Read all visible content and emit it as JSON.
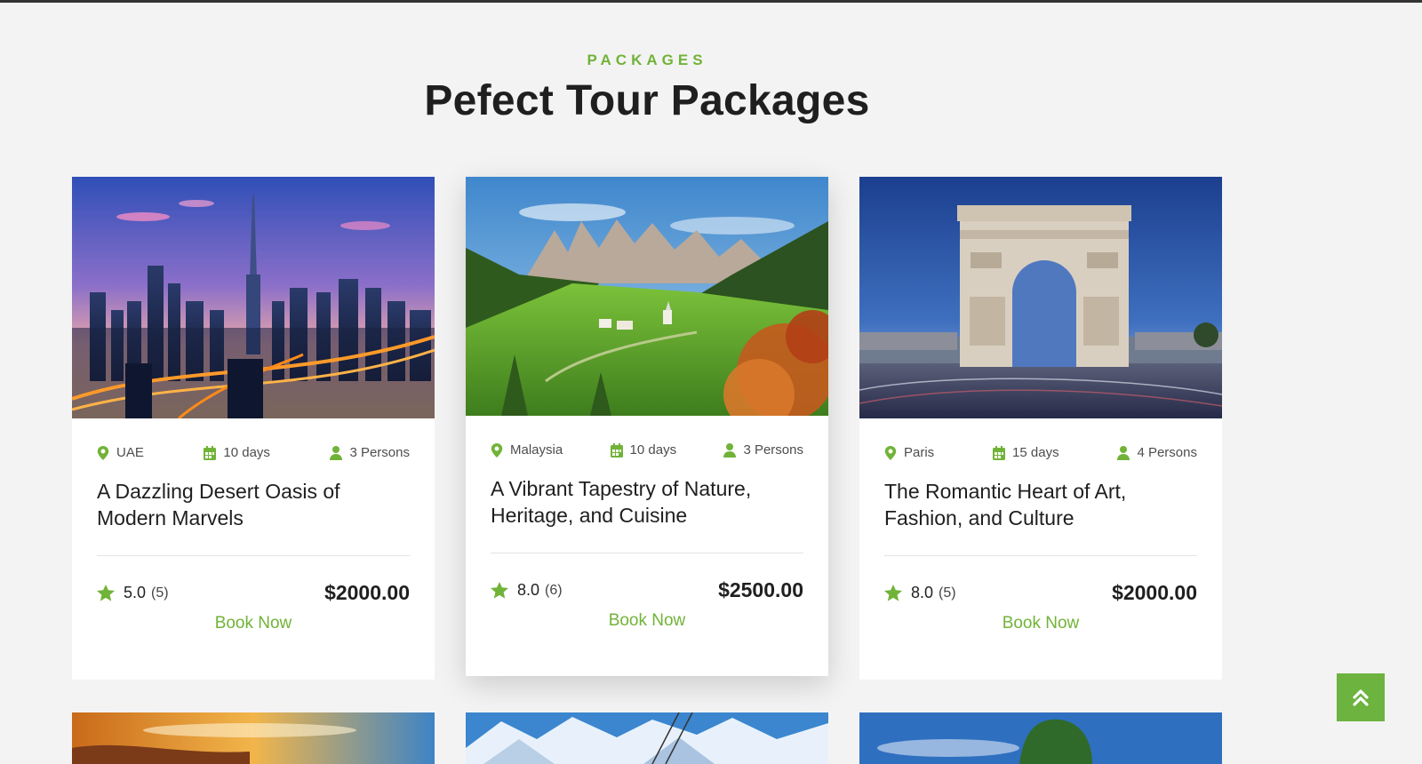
{
  "section": {
    "eyebrow": "PACKAGES",
    "title": "Pefect Tour Packages"
  },
  "colors": {
    "accent": "#71b338",
    "background": "#f3f3f3",
    "card": "#ffffff",
    "text": "#1f1f1f"
  },
  "packages": [
    {
      "location": "UAE",
      "duration": "10 days",
      "persons": "3 Persons",
      "title_line1": "A Dazzling Desert Oasis of",
      "title_line2": "Modern Marvels",
      "rating": "5.0",
      "reviews": "(5)",
      "price": "$2000.00",
      "cta": "Book Now",
      "image": "dubai-skyline-photo"
    },
    {
      "location": "Malaysia",
      "duration": "10 days",
      "persons": "3 Persons",
      "title_line1": "A Vibrant Tapestry of Nature,",
      "title_line2": "Heritage, and Cuisine",
      "rating": "8.0",
      "reviews": "(6)",
      "price": "$2500.00",
      "cta": "Book Now",
      "image": "mountain-valley-photo"
    },
    {
      "location": "Paris",
      "duration": "15 days",
      "persons": "4 Persons",
      "title_line1": "The Romantic Heart of Art,",
      "title_line2": "Fashion, and Culture",
      "rating": "8.0",
      "reviews": "(5)",
      "price": "$2000.00",
      "cta": "Book Now",
      "image": "arc-de-triomphe-photo"
    }
  ],
  "icons": {
    "location": "map-pin-icon",
    "duration": "calendar-icon",
    "persons": "user-icon",
    "rating": "star-icon",
    "scroll_top": "double-chevron-up-icon"
  }
}
